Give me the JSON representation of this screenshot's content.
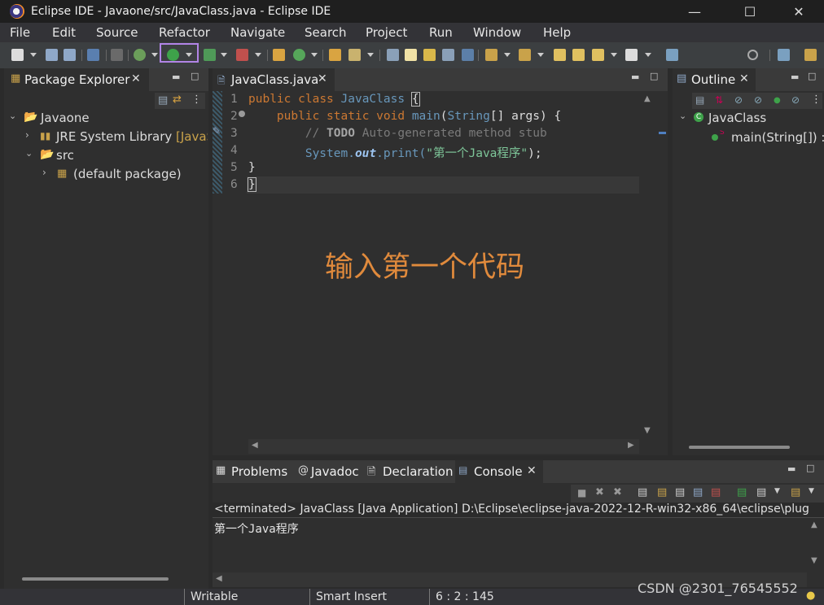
{
  "window": {
    "title": "Eclipse IDE - Javaone/src/JavaClass.java - Eclipse IDE"
  },
  "menu": [
    "File",
    "Edit",
    "Source",
    "Refactor",
    "Navigate",
    "Search",
    "Project",
    "Run",
    "Window",
    "Help"
  ],
  "package_explorer": {
    "tab": "Package Explorer",
    "project": "Javaone",
    "jre_label": "JRE System Library",
    "jre_suffix": "[JavaS",
    "src": "src",
    "package": "(default package)"
  },
  "editor": {
    "tab": "JavaClass.java",
    "line_numbers": [
      "1",
      "2",
      "3",
      "4",
      "5",
      "6"
    ],
    "code": {
      "l1_kw1": "public",
      "l1_kw2": "class",
      "l1_name": "JavaClass",
      "l1_brace": "{",
      "l2_kw1": "public",
      "l2_kw2": "static",
      "l2_kw3": "void",
      "l2_method": "main",
      "l2_type": "String",
      "l2_rest": "[] args) {",
      "l3_slash": "// ",
      "l3_todo": "TODO",
      "l3_rest": " Auto-generated method stub",
      "l4_sys": "System.",
      "l4_out": "out",
      "l4_print": ".print(",
      "l4_str": "\"第一个Java程序\"",
      "l4_end": ");",
      "l5": "}",
      "l6": "}"
    },
    "annotation": "输入第一个代码"
  },
  "outline": {
    "tab": "Outline",
    "class": "JavaClass",
    "method": "main(String[]) : v"
  },
  "bottom": {
    "tabs": {
      "problems": "Problems",
      "javadoc": "Javadoc",
      "declaration": "Declaration",
      "console": "Console"
    },
    "console_header": "<terminated> JavaClass [Java Application] D:\\Eclipse\\eclipse-java-2022-12-R-win32-x86_64\\eclipse\\plug",
    "console_output": "第一个Java程序"
  },
  "statusbar": {
    "writable": "Writable",
    "insert_mode": "Smart Insert",
    "position": "6 : 2 : 145"
  },
  "watermark": "CSDN @2301_76545552",
  "colors": {
    "run_highlight": "#b184e6",
    "annotation": "#e08a3c",
    "keyword": "#cc7832"
  },
  "icons": [
    "eclipse-logo-icon",
    "new-icon",
    "save-icon",
    "save-all-icon",
    "run-icon",
    "debug-icon",
    "search-icon",
    "package-icon",
    "class-icon",
    "method-icon",
    "console-icon",
    "lightbulb-icon"
  ]
}
